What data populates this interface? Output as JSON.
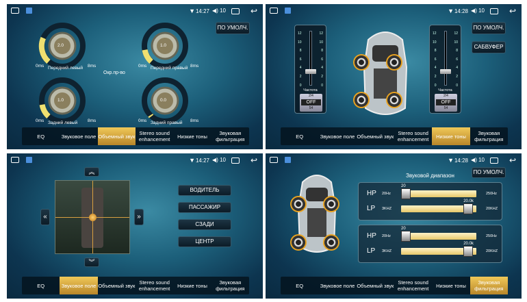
{
  "status": {
    "time1": "14:27",
    "time2": "14:28",
    "time3": "14:27",
    "time4": "14:28",
    "volume": "10",
    "volume_icon": "speaker-icon",
    "wifi_icon": "wifi-icon",
    "back_icon": "back-arrow-icon"
  },
  "tabs": [
    {
      "items": [
        "EQ",
        "Звуковое поле",
        "Объемный звук",
        "Stereo sound enhancement",
        "Низкие тоны",
        "Звуковая фильтрация"
      ],
      "active": 2
    },
    {
      "items": [
        "EQ",
        "Звуковое поле",
        "Объемный звук",
        "Stereo sound enhancement",
        "Низкие тоны",
        "Звуковая фильтрация"
      ],
      "active": 4
    },
    {
      "items": [
        "EQ",
        "Звуковое поле",
        "Объемный звук",
        "Stereo sound enhancement",
        "Низкие тоны",
        "Звуковая фильтрация"
      ],
      "active": 1
    },
    {
      "items": [
        "EQ",
        "Звуковое поле",
        "Объемный звук",
        "Stereo sound enhancement",
        "Низкие тоны",
        "Звуковая фильтрация"
      ],
      "active": 5
    }
  ],
  "p1": {
    "default_btn": "ПО УМОЛЧ.",
    "center_label": "Окр.пр-во",
    "knobs": [
      {
        "label": "Передний левый",
        "value": "2.0",
        "min": "0ms",
        "max": "8ms"
      },
      {
        "label": "Передний правый",
        "value": "1.0",
        "min": "0ms",
        "max": "8ms"
      },
      {
        "label": "Задний левый",
        "value": "1.0",
        "min": "0ms",
        "max": "8ms"
      },
      {
        "label": "Задний правый",
        "value": "0.0",
        "min": "0ms",
        "max": "8ms"
      }
    ]
  },
  "p2": {
    "default_btn": "ПО УМОЛЧ.",
    "sub_btn": "САБВУФЕР",
    "slider": {
      "ticks": [
        "12",
        "10",
        "8",
        "6",
        "4",
        "2",
        "0"
      ],
      "label": "Частота",
      "top": "2/4",
      "off": "OFF",
      "bottom": "54"
    }
  },
  "p3": {
    "buttons": [
      "ВОДИТЕЛЬ",
      "ПАССАЖИР",
      "СЗАДИ",
      "ЦЕНТР"
    ]
  },
  "p4": {
    "default_btn": "ПО УМОЛЧ.",
    "title": "Звуковой диапазон",
    "boxes": [
      {
        "hp": {
          "name": "HP",
          "lo": "20Hz",
          "val": "20",
          "hi": "250Hz"
        },
        "lp": {
          "name": "LP",
          "lo": "3KHZ",
          "val": "20.0k",
          "hi": "20KHZ"
        }
      },
      {
        "hp": {
          "name": "HP",
          "lo": "20Hz",
          "val": "20",
          "hi": "250Hz"
        },
        "lp": {
          "name": "LP",
          "lo": "3KHZ",
          "val": "20.0k",
          "hi": "20KHZ"
        }
      }
    ]
  }
}
